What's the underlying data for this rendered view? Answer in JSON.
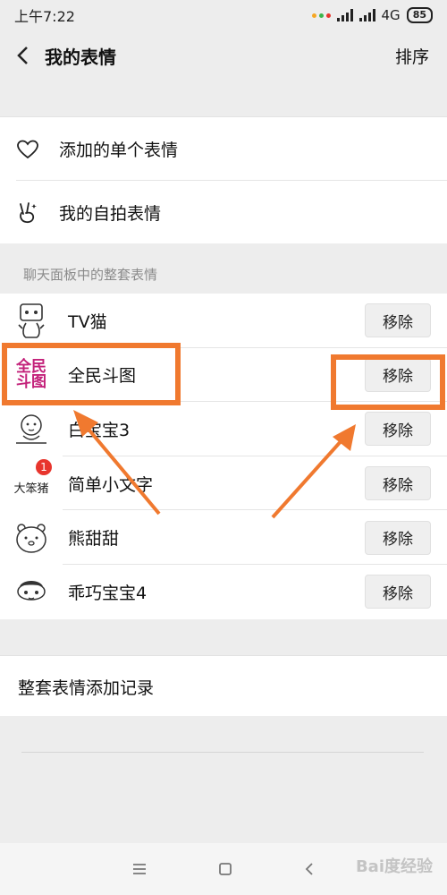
{
  "status": {
    "time": "上午7:22",
    "network": "4G",
    "battery": "85"
  },
  "header": {
    "title": "我的表情",
    "sort_label": "排序"
  },
  "menu": {
    "single_stickers": "添加的单个表情",
    "selfie_stickers": "我的自拍表情"
  },
  "group_header": "聊天面板中的整套表情",
  "packs": [
    {
      "name": "TV猫",
      "remove_label": "移除"
    },
    {
      "name": "全民斗图",
      "remove_label": "移除",
      "icon_text_top": "全民",
      "icon_text_bottom": "斗图"
    },
    {
      "name": "白宝宝3",
      "remove_label": "移除"
    },
    {
      "name": "简单小文字",
      "remove_label": "移除",
      "icon_text": "大笨猪",
      "badge": "1"
    },
    {
      "name": "熊甜甜",
      "remove_label": "移除"
    },
    {
      "name": "乖巧宝宝4",
      "remove_label": "移除"
    }
  ],
  "record_label": "整套表情添加记录",
  "watermark": "Bai度经验",
  "colors": {
    "highlight": "#f0792f",
    "badge": "#e8352d",
    "background": "#ededed"
  }
}
